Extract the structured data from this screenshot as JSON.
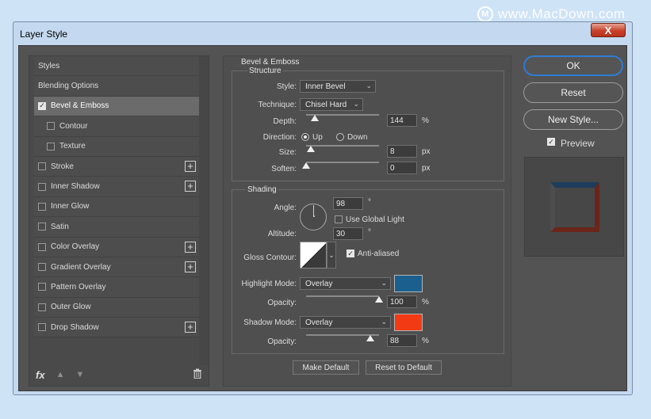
{
  "watermark": {
    "logo": "M",
    "text": "www.MacDown.com"
  },
  "window": {
    "title": "Layer Style",
    "close_label": "X"
  },
  "styles_list": {
    "items": [
      {
        "label": "Styles",
        "type": "header"
      },
      {
        "label": "Blending Options",
        "type": "header"
      },
      {
        "label": "Bevel & Emboss",
        "checked": true,
        "selected": true,
        "plus": false,
        "sub": false
      },
      {
        "label": "Contour",
        "checked": false,
        "selected": false,
        "plus": false,
        "sub": true
      },
      {
        "label": "Texture",
        "checked": false,
        "selected": false,
        "plus": false,
        "sub": true
      },
      {
        "label": "Stroke",
        "checked": false,
        "plus": true,
        "sub": false
      },
      {
        "label": "Inner Shadow",
        "checked": false,
        "plus": true,
        "sub": false
      },
      {
        "label": "Inner Glow",
        "checked": false,
        "plus": false,
        "sub": false
      },
      {
        "label": "Satin",
        "checked": false,
        "plus": false,
        "sub": false
      },
      {
        "label": "Color Overlay",
        "checked": false,
        "plus": true,
        "sub": false
      },
      {
        "label": "Gradient Overlay",
        "checked": false,
        "plus": true,
        "sub": false
      },
      {
        "label": "Pattern Overlay",
        "checked": false,
        "plus": false,
        "sub": false
      },
      {
        "label": "Outer Glow",
        "checked": false,
        "plus": false,
        "sub": false
      },
      {
        "label": "Drop Shadow",
        "checked": false,
        "plus": true,
        "sub": false
      }
    ],
    "footer": {
      "fx": "fx",
      "up": "▲",
      "down": "▼",
      "trash": "🗑"
    }
  },
  "bevel": {
    "title": "Bevel & Emboss",
    "structure_title": "Structure",
    "style_label": "Style:",
    "style_value": "Inner Bevel",
    "technique_label": "Technique:",
    "technique_value": "Chisel Hard",
    "depth_label": "Depth:",
    "depth_value": "144",
    "depth_unit": "%",
    "depth_slider": 0.12,
    "direction_label": "Direction:",
    "direction_up": "Up",
    "direction_down": "Down",
    "direction_selected": "Up",
    "size_label": "Size:",
    "size_value": "8",
    "size_unit": "px",
    "size_slider": 0.06,
    "soften_label": "Soften:",
    "soften_value": "0",
    "soften_unit": "px",
    "soften_slider": 0.0
  },
  "shading": {
    "title": "Shading",
    "angle_label": "Angle:",
    "angle_value": "98",
    "angle_unit": "°",
    "global_light_label": "Use Global Light",
    "global_light_checked": false,
    "altitude_label": "Altitude:",
    "altitude_value": "30",
    "altitude_unit": "°",
    "gloss_label": "Gloss Contour:",
    "anti_aliased_label": "Anti-aliased",
    "anti_aliased_checked": true,
    "highlight_mode_label": "Highlight Mode:",
    "highlight_mode_value": "Overlay",
    "highlight_color": "#1a5f8e",
    "highlight_opacity_label": "Opacity:",
    "highlight_opacity_value": "100",
    "highlight_opacity_unit": "%",
    "highlight_opacity_slider": 1.0,
    "shadow_mode_label": "Shadow Mode:",
    "shadow_mode_value": "Overlay",
    "shadow_color": "#f23a14",
    "shadow_opacity_label": "Opacity:",
    "shadow_opacity_value": "88",
    "shadow_opacity_unit": "%",
    "shadow_opacity_slider": 0.88
  },
  "buttons": {
    "make_default": "Make Default",
    "reset_default": "Reset to Default",
    "ok": "OK",
    "reset": "Reset",
    "new_style": "New Style...",
    "preview_label": "Preview",
    "preview_checked": true
  },
  "colors": {
    "accent": "#2f7bd4",
    "preview_top": "#1c3d5c",
    "preview_side": "#6a2418"
  }
}
